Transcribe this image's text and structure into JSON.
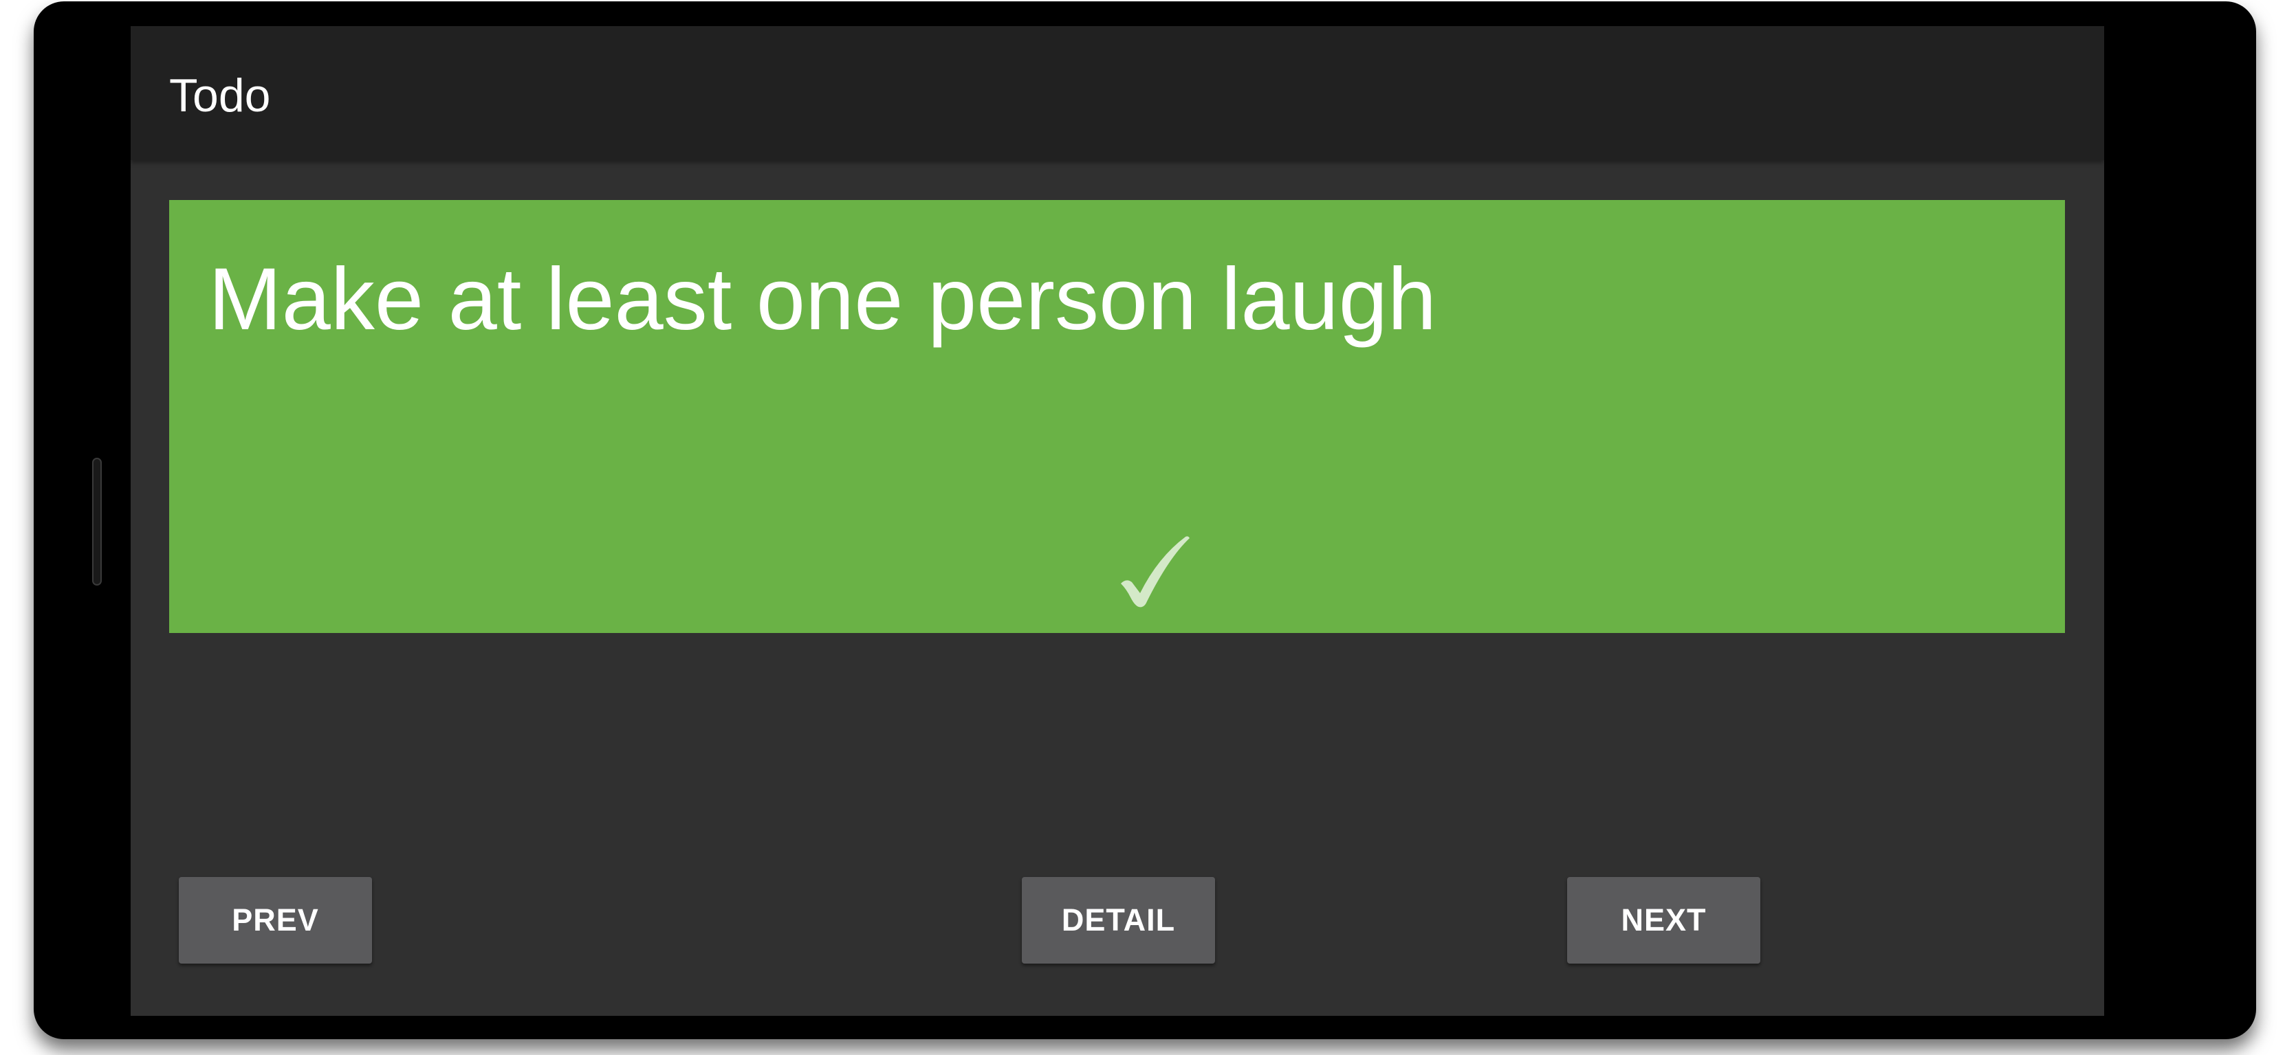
{
  "app_bar": {
    "title": "Todo"
  },
  "todo": {
    "text": "Make at least one person laugh",
    "completed_icon": "check-icon",
    "card_color": "#6ab246"
  },
  "buttons": {
    "prev_label": "PREV",
    "detail_label": "DETAIL",
    "next_label": "NEXT"
  },
  "colors": {
    "app_bar": "#212121",
    "background": "#303030",
    "button": "#5a5a5c",
    "check": "#d4e9c8"
  }
}
